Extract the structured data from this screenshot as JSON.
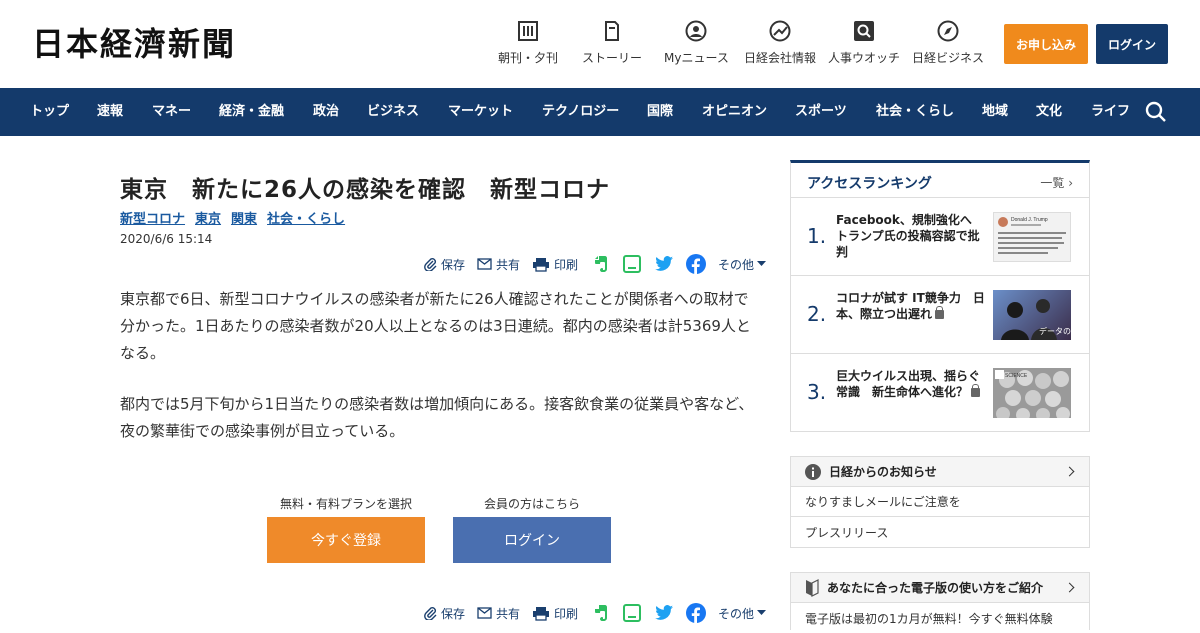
{
  "header": {
    "logo": "日本経濟新聞",
    "nav": [
      {
        "label": "朝刊・夕刊",
        "icon": "newspaper-icon"
      },
      {
        "label": "ストーリー",
        "icon": "story-icon"
      },
      {
        "label": "Myニュース",
        "icon": "user-icon"
      },
      {
        "label": "日経会社情報",
        "icon": "chart-icon"
      },
      {
        "label": "人事ウオッチ",
        "icon": "magnifier-icon"
      },
      {
        "label": "日経ビジネス",
        "icon": "compass-icon"
      }
    ],
    "apply_label": "お申し込み",
    "login_label": "ログイン"
  },
  "navbar": {
    "items": [
      "トップ",
      "速報",
      "マネー",
      "経済・金融",
      "政治",
      "ビジネス",
      "マーケット",
      "テクノロジー",
      "国際",
      "オピニオン",
      "スポーツ",
      "社会・くらし",
      "地域",
      "文化",
      "ライフ"
    ]
  },
  "article": {
    "title": "東京　新たに26人の感染を確認　新型コロナ",
    "tags": [
      "新型コロナ",
      "東京",
      "関東",
      "社会・くらし"
    ],
    "date": "2020/6/6 15:14",
    "share": {
      "save": "保存",
      "share": "共有",
      "print": "印刷",
      "more": "その他"
    },
    "paragraphs": [
      "東京都で6日、新型コロナウイルスの感染者が新たに26人確認されたことが関係者への取材で分かった。1日あたりの感染者数が20人以上となるのは3日連続。都内の感染者は計5369人となる。",
      "都内では5月下旬から1日当たりの感染者数は増加傾向にある。接客飲食業の従業員や客など、夜の繁華街での感染事例が目立っている。"
    ],
    "cta": {
      "register_caption": "無料・有料プランを選択",
      "register_label": "今すぐ登録",
      "login_caption": "会員の方はこちら",
      "login_label": "ログイン"
    }
  },
  "sidebar": {
    "ranking": {
      "title": "アクセスランキング",
      "more": "一覧",
      "items": [
        {
          "rank": "1.",
          "text": "Facebook、規制強化へ　トランプ氏の投稿容認で批判",
          "locked": false
        },
        {
          "rank": "2.",
          "text": "コロナが試す IT競争力　日本、際立つ出遅れ",
          "locked": true
        },
        {
          "rank": "3.",
          "text": "巨大ウイルス出現、揺らぐ常識　新生命体へ進化？",
          "locked": true
        }
      ],
      "thumb2_caption": "データの世紀",
      "thumb3_caption": "SCIENCE",
      "thumb1_caption": "Donald J. Trump"
    },
    "notice": {
      "title": "日経からのお知らせ",
      "rows": [
        "なりすましメールにご注意を",
        "プレスリリース"
      ]
    },
    "guide": {
      "title": "あなたに合った電子版の使い方をご紹介",
      "rows": [
        "電子版は最初の1カ月が無料！今すぐ無料体験"
      ]
    }
  },
  "colors": {
    "brand": "#143a6b",
    "accent": "#f08a1c",
    "login_blue": "#4a6fb0",
    "cta_orange": "#ef8a2a"
  }
}
